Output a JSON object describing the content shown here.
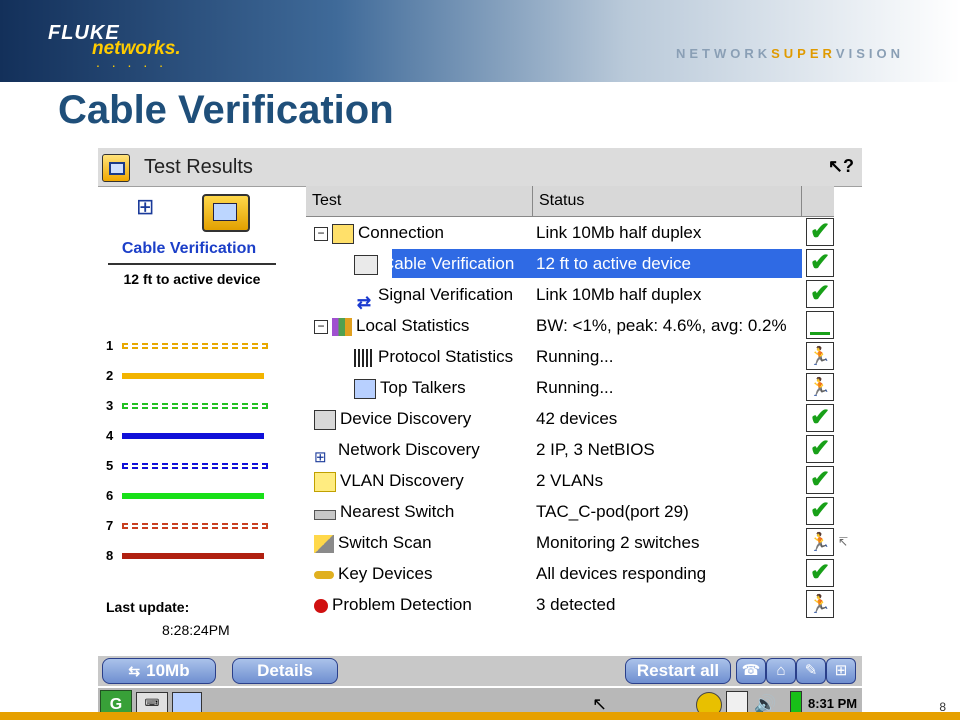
{
  "branding": {
    "logo_line1": "FLUKE",
    "logo_line2": "networks.",
    "logo_dots": ". . . . .",
    "tagline_prefix": "NETWORK",
    "tagline_accent": "SUPER",
    "tagline_suffix": "VISION"
  },
  "slide": {
    "title": "Cable Verification",
    "page_number": "8"
  },
  "window": {
    "title": "Test Results"
  },
  "left_panel": {
    "heading": "Cable Verification",
    "distance": "12 ft to active device",
    "wires": [
      {
        "num": "1",
        "color": "#e8a800",
        "style": "dashed"
      },
      {
        "num": "2",
        "color": "#f2b400",
        "style": "solid"
      },
      {
        "num": "3",
        "color": "#22c022",
        "style": "dashed"
      },
      {
        "num": "4",
        "color": "#1010d8",
        "style": "solid"
      },
      {
        "num": "5",
        "color": "#1010d8",
        "style": "dashed"
      },
      {
        "num": "6",
        "color": "#18e018",
        "style": "solid"
      },
      {
        "num": "7",
        "color": "#c84020",
        "style": "dashed"
      },
      {
        "num": "8",
        "color": "#b02010",
        "style": "solid"
      }
    ],
    "last_update_label": "Last update:",
    "last_update_time": "8:28:24PM"
  },
  "grid": {
    "headers": {
      "test": "Test",
      "status": "Status"
    },
    "rows": [
      {
        "test": "Connection",
        "status": "Link 10Mb half duplex",
        "icon": "connection-icon",
        "indicator": "ok",
        "expander": "−"
      },
      {
        "test": "Cable Verification",
        "status": "12 ft to active device",
        "icon": "cable-verification-icon",
        "indicator": "ok"
      },
      {
        "test": "Signal Verification",
        "status": "Link 10Mb half duplex",
        "icon": "signal-verification-icon",
        "indicator": "ok"
      },
      {
        "test": "Local Statistics",
        "status": "BW: <1%, peak: 4.6%, avg: 0.2%",
        "icon": "local-statistics-icon",
        "indicator": "bar",
        "expander": "−"
      },
      {
        "test": "Protocol Statistics",
        "status": "Running...",
        "icon": "protocol-statistics-icon",
        "indicator": "running"
      },
      {
        "test": "Top Talkers",
        "status": "Running...",
        "icon": "top-talkers-icon",
        "indicator": "running"
      },
      {
        "test": "Device Discovery",
        "status": "42 devices",
        "icon": "device-discovery-icon",
        "indicator": "ok"
      },
      {
        "test": "Network Discovery",
        "status": "2 IP, 3 NetBIOS",
        "icon": "network-discovery-icon",
        "indicator": "ok"
      },
      {
        "test": "VLAN Discovery",
        "status": "2 VLANs",
        "icon": "vlan-discovery-icon",
        "indicator": "ok"
      },
      {
        "test": "Nearest Switch",
        "status": "TAC_C-pod(port 29)",
        "icon": "nearest-switch-icon",
        "indicator": "ok"
      },
      {
        "test": "Switch Scan",
        "status": "Monitoring 2 switches",
        "icon": "switch-scan-icon",
        "indicator": "running"
      },
      {
        "test": "Key Devices",
        "status": "All devices responding",
        "icon": "key-devices-icon",
        "indicator": "ok"
      },
      {
        "test": "Problem Detection",
        "status": "3 detected",
        "icon": "problem-detection-icon",
        "indicator": "running"
      }
    ],
    "selected_row": "Cable Verification"
  },
  "toolbar": {
    "speed_label": "10Mb",
    "details_label": "Details",
    "restart_label": "Restart all"
  },
  "taskbar": {
    "clock": "8:31 PM"
  },
  "glyphs": {
    "check": "✔",
    "runner": "🏃",
    "side": "↸"
  }
}
